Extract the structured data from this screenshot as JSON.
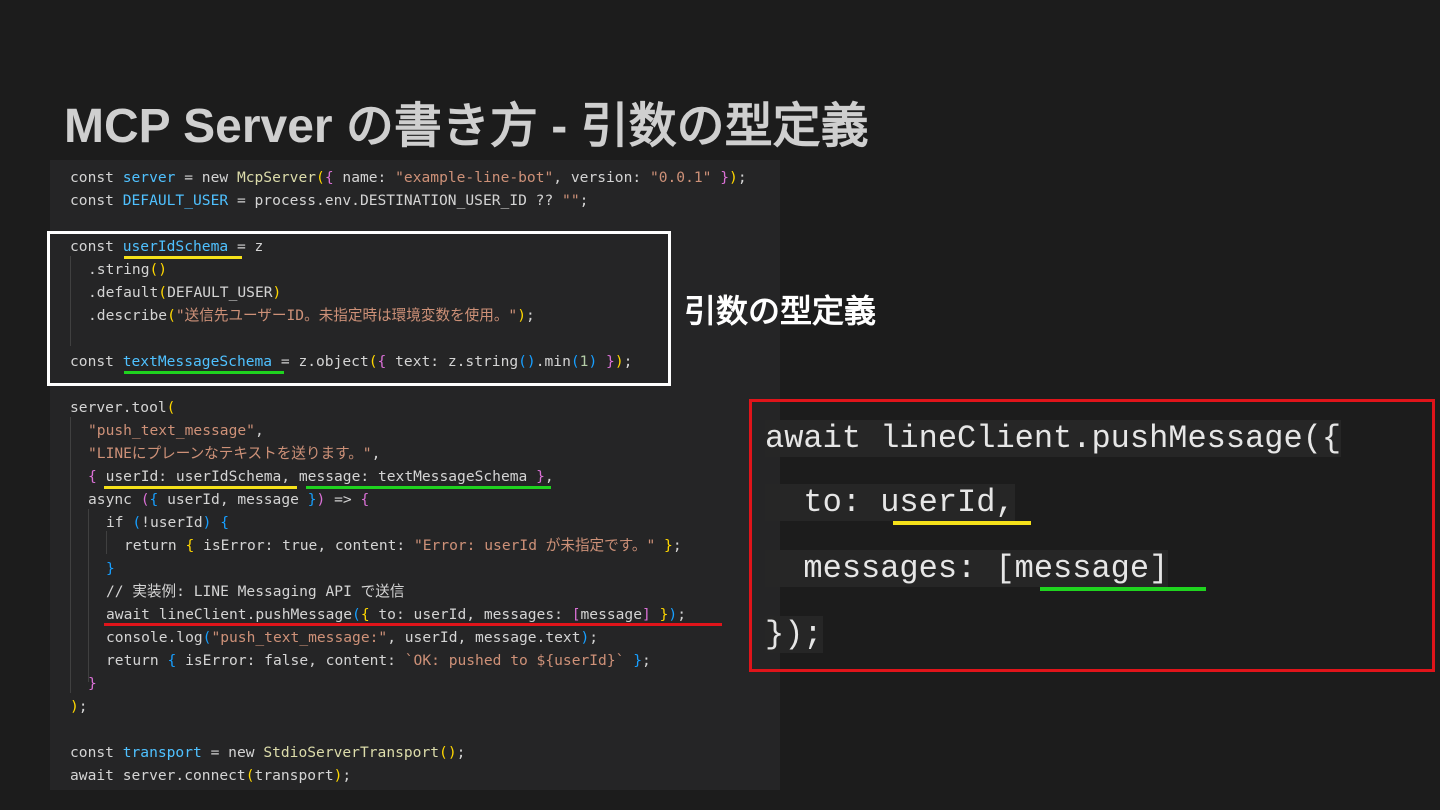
{
  "title": "MCP Server の書き方 - 引数の型定義",
  "annotation": {
    "label": "引数の型定義"
  },
  "code": {
    "l1_a": "const ",
    "l1_server": "server",
    "l1_b": " = new ",
    "l1_fn": "McpServer",
    "l1_p1": "(",
    "l1_c1": "{",
    "l1_c": " name: ",
    "l1_s1": "\"example-line-bot\"",
    "l1_d": ", version: ",
    "l1_s2": "\"0.0.1\"",
    "l1_c2": " }",
    "l1_p2": ")",
    "l1_e": ";",
    "l2_a": "const ",
    "l2_var": "DEFAULT_USER",
    "l2_b": " = process.env.DESTINATION_USER_ID ?? ",
    "l2_s": "\"\"",
    "l2_e": ";",
    "l3_a": "const ",
    "l3_var": "userIdSchema",
    "l3_b": " = z",
    "l4": ".string",
    "l4_p": "()",
    "l5_a": ".default",
    "l5_p1": "(",
    "l5_b": "DEFAULT_USER",
    "l5_p2": ")",
    "l6_a": ".describe",
    "l6_p1": "(",
    "l6_s": "\"送信先ユーザーID。未指定時は環境変数を使用。\"",
    "l6_p2": ")",
    "l6_e": ";",
    "l7_a": "const ",
    "l7_var": "textMessageSchema",
    "l7_b": " = z.object",
    "l7_p1": "(",
    "l7_c1": "{",
    "l7_c": " text: z.string",
    "l7_p3": "()",
    "l7_d": ".min",
    "l7_p4": "(",
    "l7_n": "1",
    "l7_p5": ")",
    "l7_c2": " }",
    "l7_p2": ")",
    "l7_e": ";",
    "l8_a": "server.tool",
    "l8_p": "(",
    "l9_s": "\"push_text_message\"",
    "l9_e": ",",
    "l10_s": "\"LINEにプレーンなテキストを送ります。\"",
    "l10_e": ",",
    "l11_c1": "{",
    "l11_a": " userId: userIdSchema, message: textMessageSchema ",
    "l11_c2": "}",
    "l11_e": ",",
    "l12_a": "async ",
    "l12_p1": "(",
    "l12_c1": "{",
    "l12_b": " userId, message ",
    "l12_c2": "}",
    "l12_p2": ")",
    "l12_c": " => ",
    "l12_c3": "{",
    "l13_a": "if ",
    "l13_p1": "(",
    "l13_b": "!userId",
    "l13_p2": ")",
    "l13_c": " ",
    "l13_c1": "{",
    "l14_a": "return ",
    "l14_c1": "{",
    "l14_b": " isError: true, content: ",
    "l14_s": "\"Error: userId が未指定です。\"",
    "l14_c2": " }",
    "l14_e": ";",
    "l15_c": "}",
    "l16": "// 実装例: LINE Messaging API で送信",
    "l17_a": "await lineClient.pushMessage",
    "l17_p1": "(",
    "l17_c1": "{",
    "l17_b": " to: userId, messages: ",
    "l17_k1": "[",
    "l17_m": "message",
    "l17_k2": "]",
    "l17_c2": " }",
    "l17_p2": ")",
    "l17_e": ";",
    "l18_a": "console.log",
    "l18_p1": "(",
    "l18_s": "\"push_text_message:\"",
    "l18_b": ", userId, message.text",
    "l18_p2": ")",
    "l18_e": ";",
    "l19_a": "return ",
    "l19_c1": "{",
    "l19_b": " isError: false, content: ",
    "l19_s": "`OK: pushed to ${userId}`",
    "l19_c2": " }",
    "l19_e": ";",
    "l20_c": "}",
    "l21_p": ")",
    "l21_e": ";",
    "l22_a": "const ",
    "l22_var": "transport",
    "l22_b": " = new ",
    "l22_fn": "StdioServerTransport",
    "l22_p": "()",
    "l22_e": ";",
    "l23_a": "await server.connect",
    "l23_p1": "(",
    "l23_b": "transport",
    "l23_p2": ")",
    "l23_e": ";"
  },
  "zoom": {
    "z1": "await lineClient.pushMessage({",
    "z2_a": "  to: ",
    "z2_b": "userId",
    "z2_c": ",",
    "z3_a": "  messages: ",
    "z3_k1": "[",
    "z3_b": "message",
    "z3_k2": "]",
    "z4": "});"
  },
  "colors": {
    "background": "#1c1c1c",
    "yellow_underline": "#f5e11a",
    "green_underline": "#1fd31f",
    "red_highlight": "#e0141a"
  }
}
